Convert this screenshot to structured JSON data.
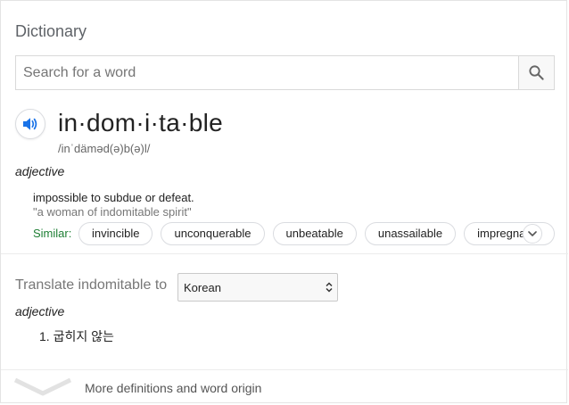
{
  "card": {
    "title": "Dictionary"
  },
  "search": {
    "placeholder": "Search for a word"
  },
  "entry": {
    "headword": "in·dom·i·ta·ble",
    "phonetic": "/inˈdäməd(ə)b(ə)l/",
    "part_of_speech": "adjective",
    "definition": "impossible to subdue or defeat.",
    "example": "\"a woman of indomitable spirit\"",
    "similar_label": "Similar:",
    "similar": [
      "invincible",
      "unconquerable",
      "unbeatable",
      "unassailable",
      "impregnable"
    ]
  },
  "translate": {
    "label": "Translate indomitable to",
    "selected_language": "Korean",
    "part_of_speech": "adjective",
    "items": [
      "1. 굽히지 않는"
    ]
  },
  "footer": {
    "more_label": "More definitions and word origin"
  },
  "colors": {
    "similar_label": "#1e7e34",
    "speaker_icon": "#1a73e8"
  },
  "icons": [
    "search-icon",
    "speaker-icon",
    "chevron-down-icon",
    "select-arrows-icon",
    "expand-chevron-icon"
  ]
}
